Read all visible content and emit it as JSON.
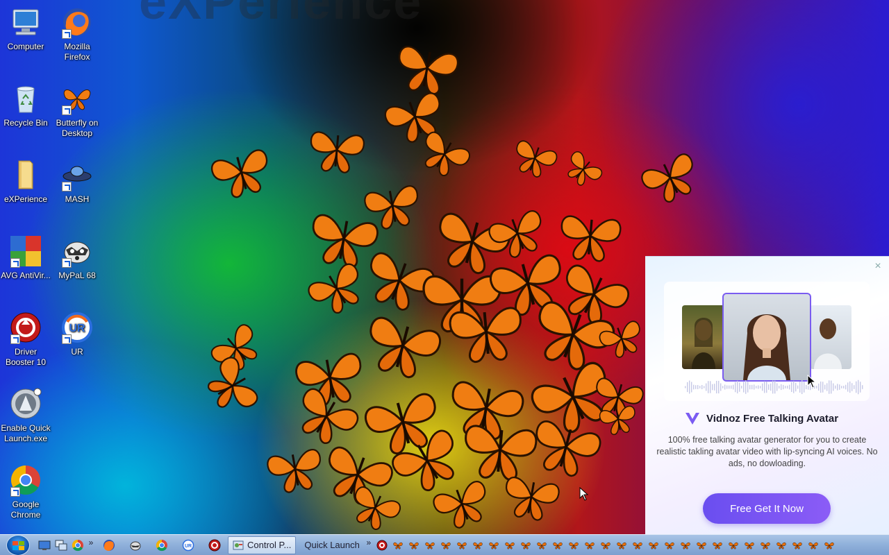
{
  "wallpaper": {
    "faded_text": "eXPerience"
  },
  "desktop": {
    "icons": [
      {
        "label": "Computer",
        "icon": "computer-icon"
      },
      {
        "label": "Mozilla Firefox",
        "icon": "firefox-icon"
      },
      {
        "label": "Recycle Bin",
        "icon": "recycle-bin-icon"
      },
      {
        "label": "Butterfly on Desktop",
        "icon": "butterfly-icon"
      },
      {
        "label": "eXPerience",
        "icon": "folder-icon"
      },
      {
        "label": "MASH",
        "icon": "ufo-icon"
      },
      {
        "label": "AVG AntiVir...",
        "icon": "avg-icon"
      },
      {
        "label": "MyPaL 68",
        "icon": "raccoon-icon"
      },
      {
        "label": "Driver Booster 10",
        "icon": "driver-booster-icon"
      },
      {
        "label": "UR",
        "icon": "ur-browser-icon"
      },
      {
        "label": "Enable Quick Launch.exe",
        "icon": "quick-launch-icon"
      },
      {
        "label": "Google Chrome",
        "icon": "chrome-icon"
      }
    ]
  },
  "popup": {
    "brand": "Vidnoz Free Talking Avatar",
    "description": "100% free talking avatar generator for you to create realistic takling avatar video with lip-syncing AI voices. No ads, no dowloading.",
    "cta": "Free Get It Now",
    "close": "×",
    "accent": "#7b5cf2"
  },
  "taskbar": {
    "start": "Start",
    "quick_launch_more": "»",
    "task_label": "Control P...",
    "toolbar_label": "Quick Launch",
    "toolbar_more": "»"
  }
}
